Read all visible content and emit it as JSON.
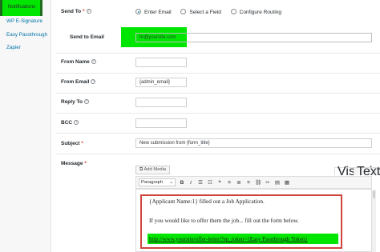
{
  "sidebar": {
    "items": [
      {
        "label": "Notifications"
      },
      {
        "label": "WP E-Signature"
      },
      {
        "label": "Easy Passthrough"
      },
      {
        "label": "Zapier"
      }
    ]
  },
  "form": {
    "send_to": {
      "label": "Send To",
      "options": [
        "Enter Email",
        "Select a Field",
        "Configure Routing"
      ],
      "selected": "Enter Email"
    },
    "send_to_email": {
      "label": "Send to Email",
      "value": "hr@yoursite.com"
    },
    "from_name": {
      "label": "From Name",
      "value": ""
    },
    "from_email": {
      "label": "From Email",
      "value": "{admin_email}"
    },
    "reply_to": {
      "label": "Reply To",
      "value": ""
    },
    "bcc": {
      "label": "BCC",
      "value": ""
    },
    "subject": {
      "label": "Subject",
      "value": "New submission from {form_title}"
    },
    "message": {
      "label": "Message",
      "add_media": "Add Media",
      "tabs": [
        "Visual",
        "Text"
      ],
      "format_select": "Paragraph",
      "toolbar": [
        "B",
        "I",
        "☰",
        "☷",
        "❝",
        "≡",
        "≣",
        "≡",
        "⛓",
        "✂",
        "▤",
        "▦"
      ],
      "lines": [
        "{Applicant Name:1} filled out a Job Application.",
        "If you would like to offer them the job... fill out the form below.",
        "http://www.yoursite/offer-letter/?ep_token={Easy Passthrough Token}"
      ]
    }
  },
  "required_mark": "*",
  "help_glyph": "?",
  "colors": {
    "highlight": "#00e600",
    "callout": "#d0443e",
    "link": "#0073aa"
  }
}
